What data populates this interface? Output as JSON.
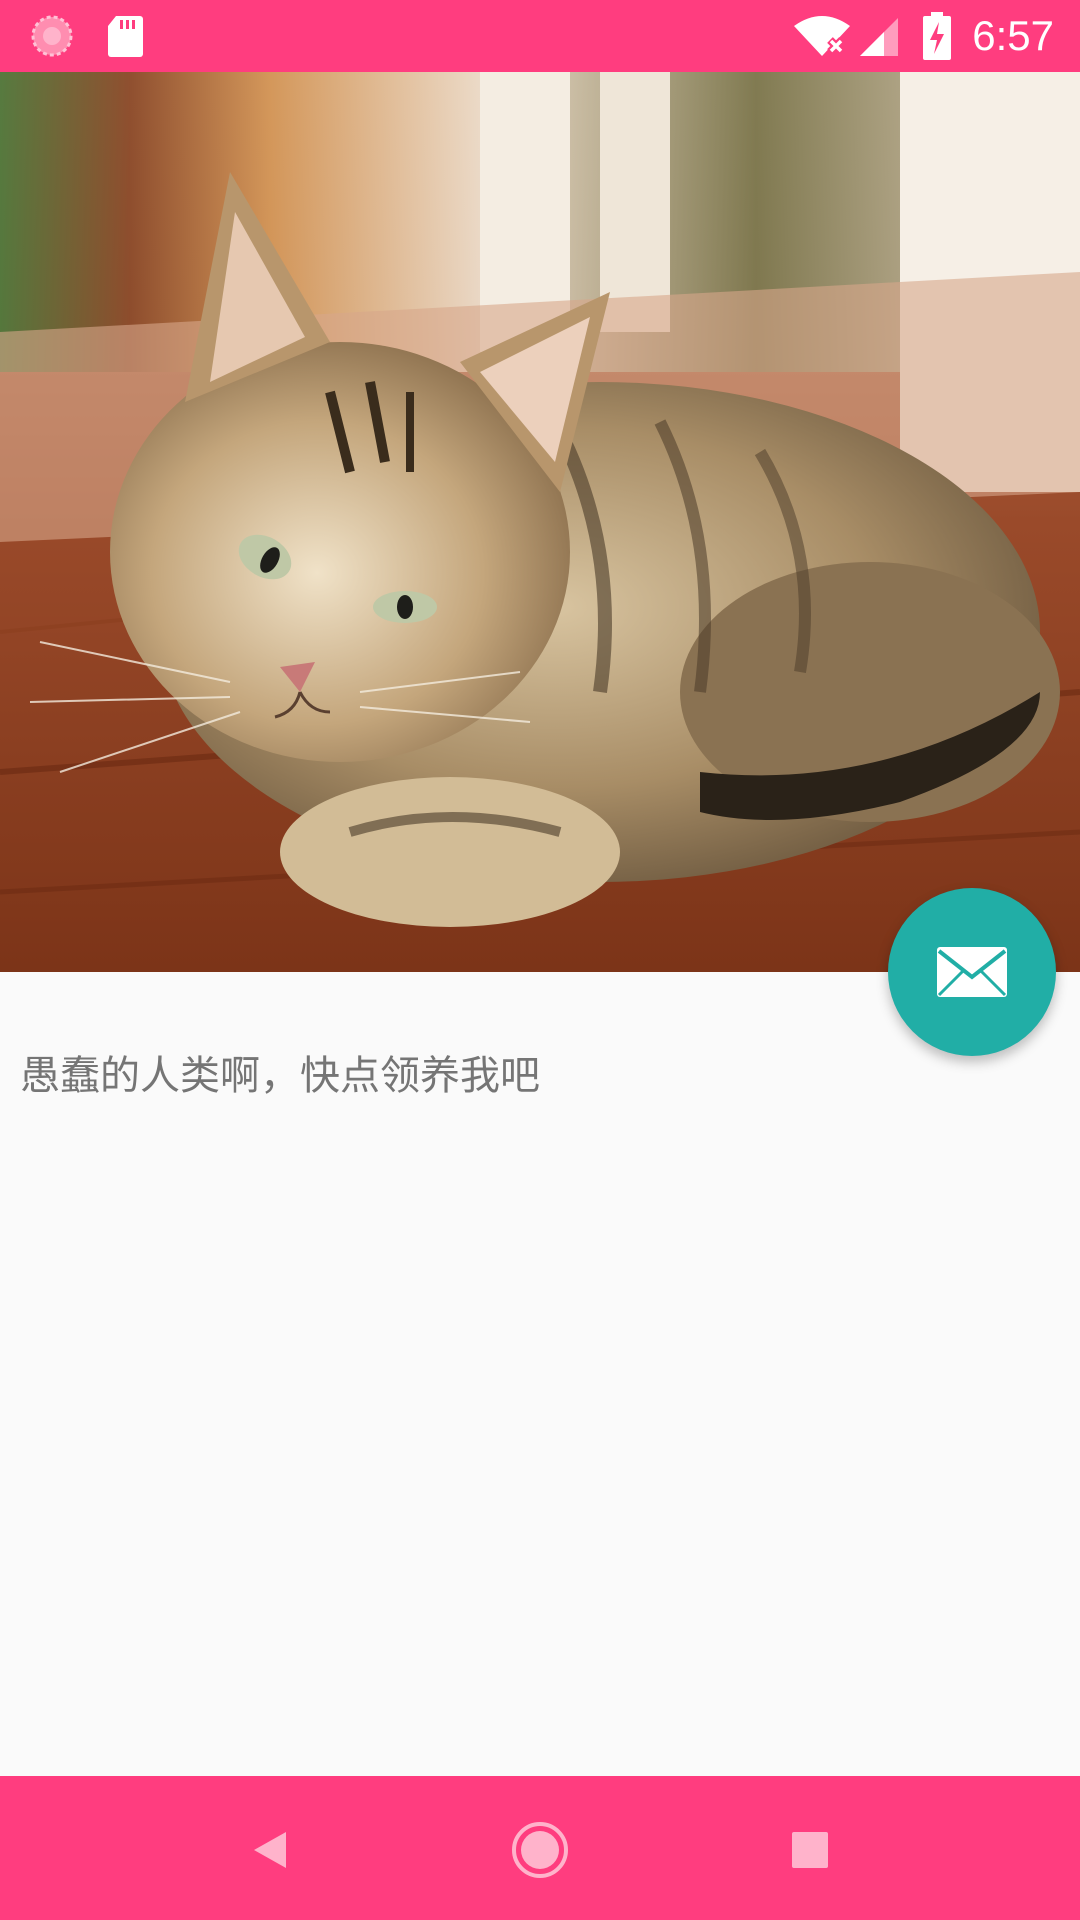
{
  "status_bar": {
    "time": "6:57",
    "background_color": "#ff3d7f",
    "icons": [
      "spinner-icon",
      "sd-card-icon",
      "wifi-no-internet-icon",
      "cell-signal-icon",
      "battery-charging-icon"
    ]
  },
  "hero": {
    "image_subject": "tabby-kitten-photo"
  },
  "fab": {
    "icon": "email-icon",
    "color": "#21aea6"
  },
  "content": {
    "text": "愚蠢的人类啊，快点领养我吧"
  },
  "nav_bar": {
    "background_color": "#ff3d7f",
    "icons": [
      "back-icon",
      "home-icon",
      "recents-icon"
    ]
  }
}
